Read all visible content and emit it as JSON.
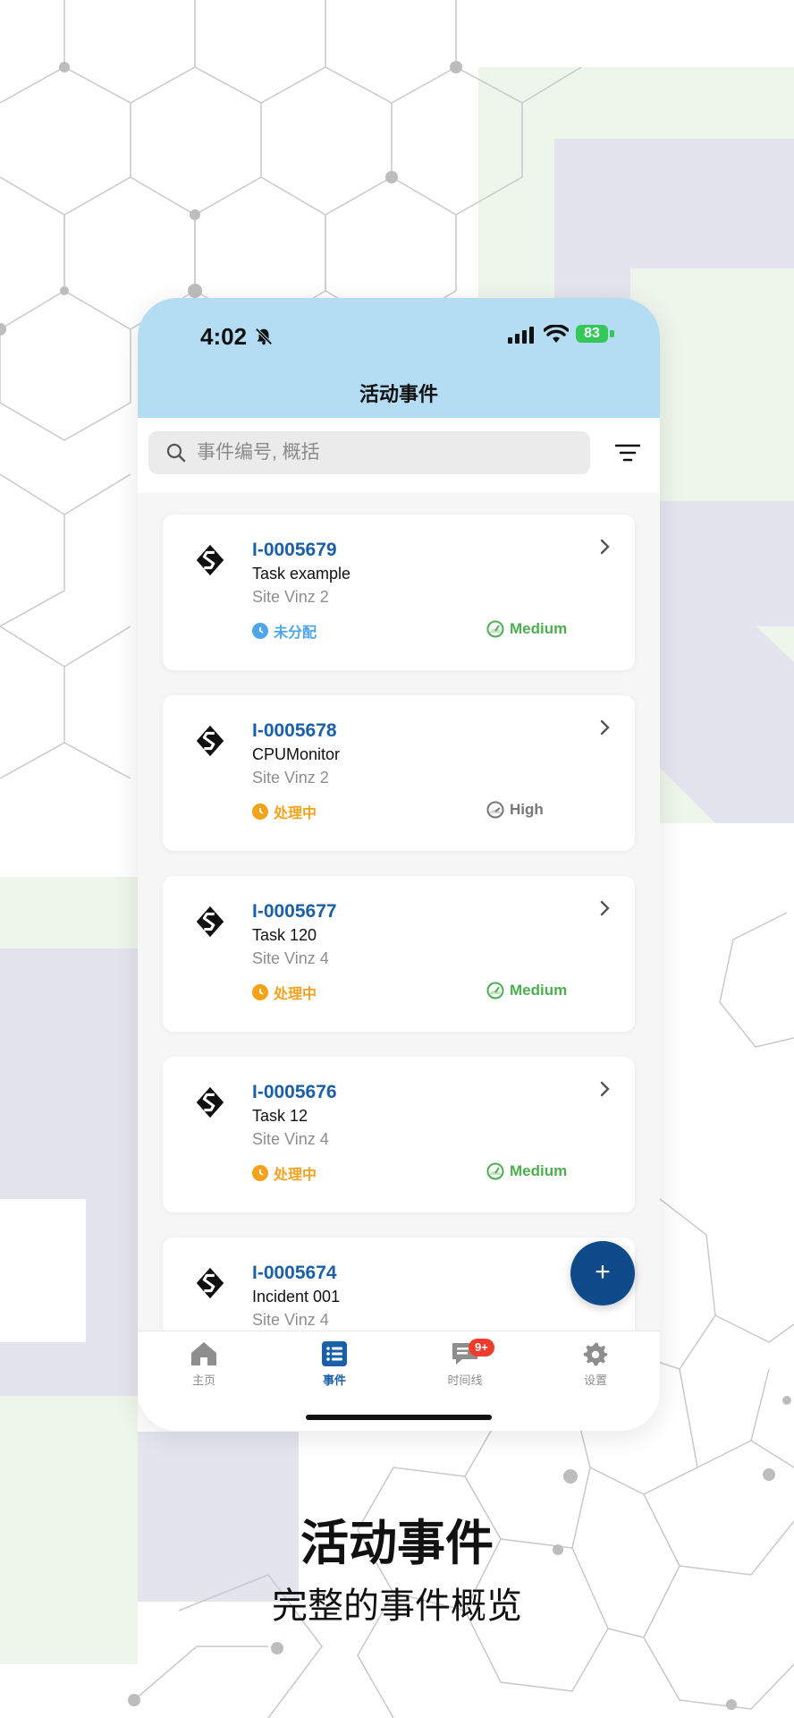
{
  "status_bar": {
    "time": "4:02",
    "battery": "83"
  },
  "header": {
    "title": "活动事件"
  },
  "search": {
    "placeholder": "事件编号, 概括"
  },
  "incidents": [
    {
      "id": "I-0005679",
      "title": "Task example",
      "site": "Site Vinz 2",
      "status": "未分配",
      "status_color": "#4ea6e8",
      "priority": "Medium",
      "priority_color": "#4caf50"
    },
    {
      "id": "I-0005678",
      "title": "CPUMonitor",
      "site": "Site Vinz 2",
      "status": "处理中",
      "status_color": "#f5a21b",
      "priority": "High",
      "priority_color": "#777777"
    },
    {
      "id": "I-0005677",
      "title": "Task 120",
      "site": "Site Vinz 4",
      "status": "处理中",
      "status_color": "#f5a21b",
      "priority": "Medium",
      "priority_color": "#4caf50"
    },
    {
      "id": "I-0005676",
      "title": "Task 12",
      "site": "Site Vinz 4",
      "status": "处理中",
      "status_color": "#f5a21b",
      "priority": "Medium",
      "priority_color": "#4caf50"
    },
    {
      "id": "I-0005674",
      "title": "Incident 001",
      "site": "Site Vinz 4"
    }
  ],
  "fab": {
    "label": "+"
  },
  "tabs": [
    {
      "label": "主页",
      "icon": "home-icon"
    },
    {
      "label": "事件",
      "icon": "list-icon",
      "active": true
    },
    {
      "label": "时间线",
      "icon": "chat-icon",
      "badge": "9+"
    },
    {
      "label": "设置",
      "icon": "gear-icon"
    }
  ],
  "caption": {
    "title": "活动事件",
    "subtitle": "完整的事件概览"
  },
  "colors": {
    "header_bg": "#b4dcf2",
    "accent": "#1b5fa8",
    "fab": "#0f4a8a"
  }
}
